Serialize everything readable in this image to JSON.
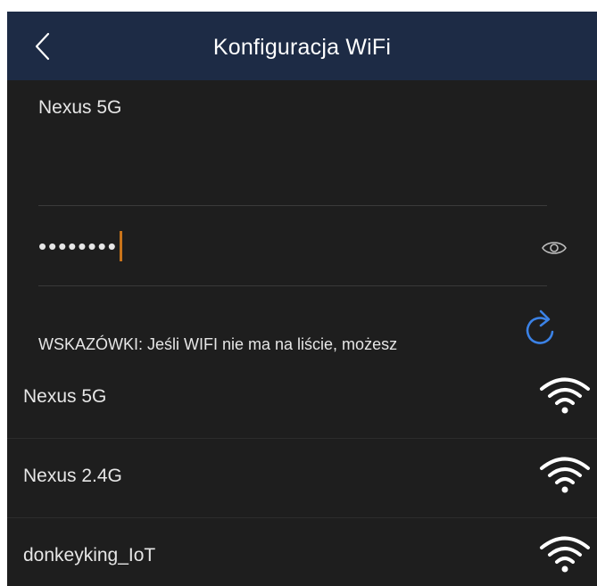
{
  "header": {
    "title": "Konfiguracja WiFi",
    "back_icon": "chevron-left-icon"
  },
  "form": {
    "ssid_value": "Nexus 5G",
    "password_mask": "••••••••",
    "eye_icon": "eye-icon",
    "refresh_icon": "refresh-icon",
    "tip_text": "WSKAZÓWKI: Jeśli WIFI nie ma na liście, możesz"
  },
  "networks": [
    {
      "name": "Nexus 5G",
      "signal_icon": "wifi-full-icon"
    },
    {
      "name": "Nexus 2.4G",
      "signal_icon": "wifi-full-icon"
    },
    {
      "name": "donkeyking_IoT",
      "signal_icon": "wifi-full-icon"
    }
  ],
  "colors": {
    "header_bg": "#1d2b45",
    "screen_bg": "#1e1e1e",
    "accent_blue": "#3b82e6",
    "caret": "#c8731a"
  }
}
